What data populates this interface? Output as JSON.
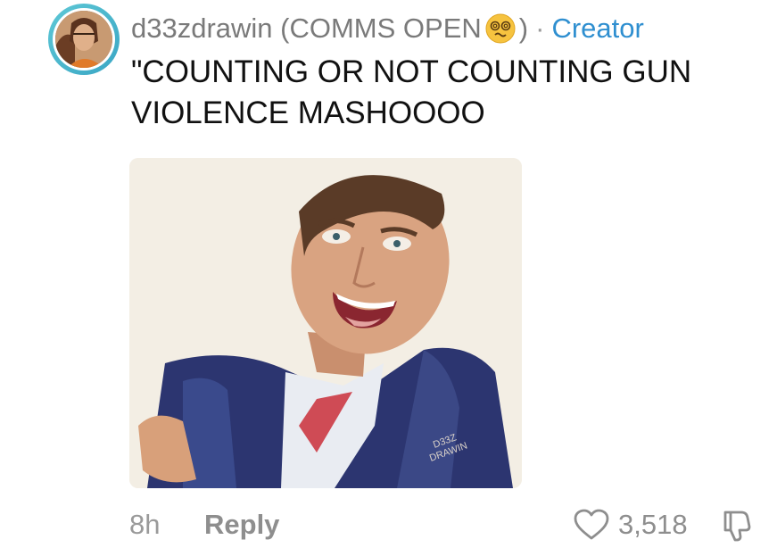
{
  "comment": {
    "username": "d33zdrawin (COMMS OPEN",
    "username_close": ")",
    "separator": "·",
    "badge": "Creator",
    "text_line1": "\"COUNTING OR NOT COUNTING GUN",
    "text_line2": "VIOLENCE MASHOOOO",
    "image": {
      "signature": "D33Z DRAWIN",
      "icon": "drawing-of-man-in-suit"
    },
    "time": "8h",
    "reply_label": "Reply",
    "like_count": "3,518",
    "icons": [
      "avatar",
      "dizzy-face-emoji",
      "heart-icon",
      "thumbs-down-icon"
    ]
  },
  "colors": {
    "creator": "#2f8fd0",
    "muted": "#8e8e8e",
    "ring": "#3aa6c4"
  }
}
